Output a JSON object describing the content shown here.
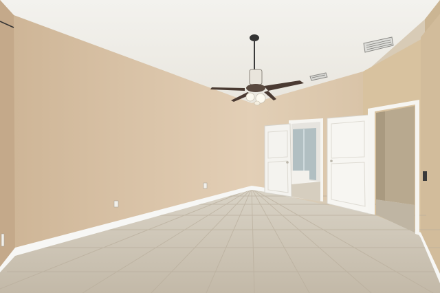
{
  "scene": {
    "colors": {
      "ceiling": "#f1efe9",
      "wall_left": "#d9c3a8",
      "wall_back": "#dfccb2",
      "wall_right": "#cdb79b",
      "floor": "#cfc7b8",
      "baseboard": "#f7f7f5",
      "door": "#f4f3ef",
      "fan_blade": "#4a3a32"
    },
    "icons": [
      "ceiling-fan-icon",
      "air-vent-icon",
      "electrical-outlet-icon"
    ]
  }
}
